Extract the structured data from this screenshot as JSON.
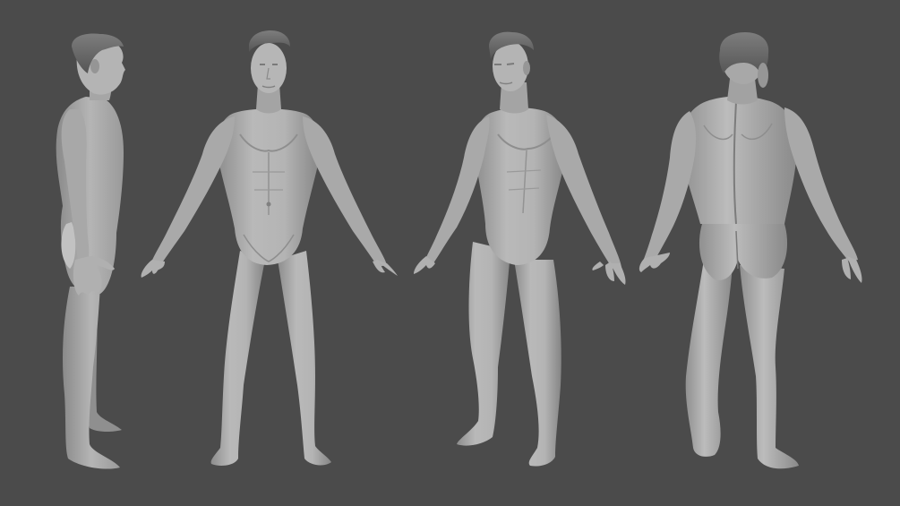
{
  "scene": {
    "background": "#4b4b4b",
    "skin_color": "#aaaaaa",
    "skin_shadow": "#7c7c7c",
    "skin_highlight": "#c6c6c6",
    "hair_color": "#6a6a6a",
    "views": [
      "side",
      "front",
      "three-quarter",
      "back"
    ]
  }
}
